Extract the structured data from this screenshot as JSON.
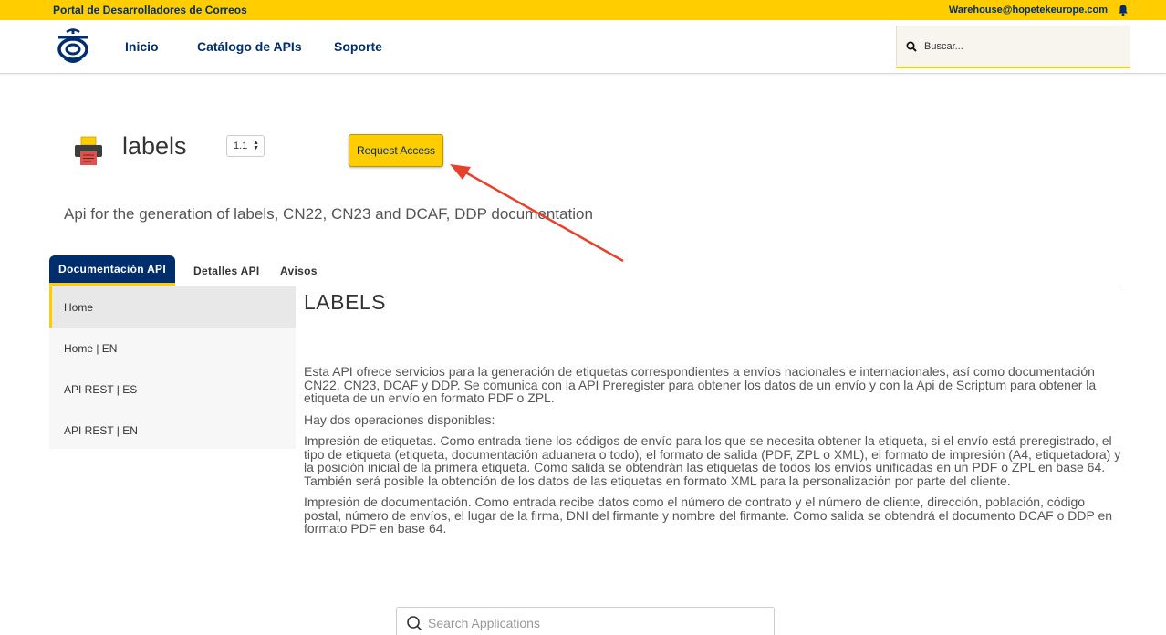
{
  "topbar": {
    "portal_title": "Portal de Desarrolladores de Correos",
    "user_email": "Warehouse@hopetekeurope.com",
    "bell_icon": "bell-icon"
  },
  "nav": {
    "logo_icon": "correos-horn-logo",
    "links": [
      "Inicio",
      "Catálogo de APIs",
      "Soporte"
    ],
    "search_placeholder": "Buscar..."
  },
  "api": {
    "name": "labels",
    "version": "1.1",
    "request_access_label": "Request Access",
    "description": "Api for the generation of labels, CN22, CN23 and DCAF, DDP documentation"
  },
  "tabs": [
    "Documentación API",
    "Detalles API",
    "Avisos"
  ],
  "sidebar": {
    "items": [
      "Home",
      "Home | EN",
      "API REST | ES",
      "API REST | EN"
    ],
    "active_index": 0
  },
  "content": {
    "title": "LABELS",
    "paragraphs": [
      "Esta API ofrece servicios para la generación de etiquetas correspondientes a envíos nacionales e internacionales, así como documentación CN22, CN23, DCAF y DDP. Se comunica con la API Preregister para obtener los datos de un envío y con la Api de Scriptum para obtener la etiqueta de un envío en formato PDF o ZPL.",
      "Hay dos operaciones disponibles:",
      "Impresión de etiquetas. Como entrada tiene los códigos de envío para los que se necesita obtener la etiqueta, si el envío está preregistrado, el tipo de etiqueta (etiqueta, documentación aduanera o todo), el formato de salida (PDF, ZPL o XML), el formato de impresión (A4, etiquetadora) y la posición inicial de la primera etiqueta. Como salida se obtendrán las etiquetas de todos los envíos unificadas en un PDF o ZPL en base 64. También será posible la obtención de los datos de las etiquetas en formato XML para la personalización por parte del cliente.",
      "Impresión de documentación. Como entrada recibe datos como el número de contrato y el número de cliente, dirección, población, código postal, número de envíos, el lugar de la firma, DNI del firmante y nombre del firmante. Como salida se obtendrá el documento DCAF o DDP en formato PDF en base 64."
    ]
  },
  "app_search": {
    "placeholder": "Search Applications"
  },
  "colors": {
    "brand_yellow": "#ffcd00",
    "brand_navy": "#002e6d",
    "annotation_red": "#e8402a"
  }
}
